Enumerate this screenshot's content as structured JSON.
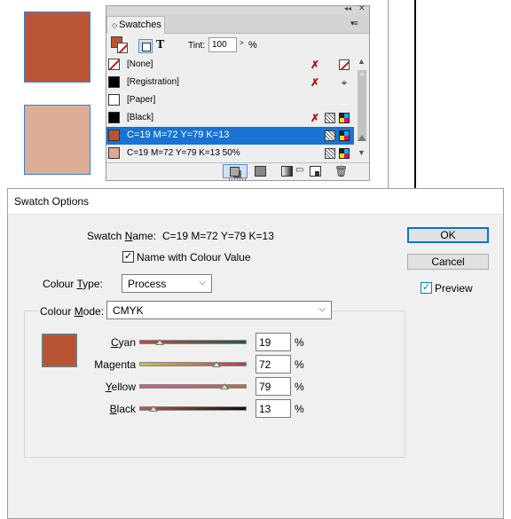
{
  "canvas": {
    "swatch_square_colors": [
      "#bb5738",
      "#ddae95"
    ]
  },
  "swatches_panel": {
    "tab_title": "Swatches",
    "tint_label": "Tint:",
    "tint_value": "100",
    "tint_unit": "%",
    "fill_color": "#b95433",
    "swatches": [
      {
        "name": "[None]",
        "chip": "none",
        "selected": false
      },
      {
        "name": "[Registration]",
        "chip": "#000000",
        "selected": false
      },
      {
        "name": "[Paper]",
        "chip": "#ffffff",
        "selected": false
      },
      {
        "name": "[Black]",
        "chip": "#000000",
        "selected": false
      },
      {
        "name": "C=19 M=72 Y=79 K=13",
        "chip": "#b95433",
        "selected": true
      },
      {
        "name": "C=19 M=72 Y=79 K=13 50%",
        "chip": "#dcaa91",
        "selected": false
      }
    ],
    "icons": {
      "no_edit": "pencil-crossed-icon",
      "registration": "registration-mark-icon",
      "process": "process-color-icon",
      "cmyk": "cmyk-mode-icon",
      "new_swatch": "new-swatch-icon",
      "delete": "trash-icon"
    }
  },
  "dialog": {
    "title": "Swatch Options",
    "swatch_name_label_pre": "Swatch ",
    "swatch_name_label_u": "N",
    "swatch_name_label_post": "ame:",
    "swatch_name_value": "C=19 M=72 Y=79 K=13",
    "name_with_colour_value_label": "Name with Colour Value",
    "name_with_colour_value_checked": true,
    "colour_type_label_pre": "Colour ",
    "colour_type_label_u": "T",
    "colour_type_label_post": "ype:",
    "colour_type_value": "Process",
    "colour_mode_label_pre": "Colour ",
    "colour_mode_label_u": "M",
    "colour_mode_label_post": "ode:",
    "colour_mode_value": "CMYK",
    "ok_label": "OK",
    "cancel_label": "Cancel",
    "preview_label": "Preview",
    "preview_checked": true,
    "preview_color": "#b95433",
    "sliders": [
      {
        "label_u": "C",
        "label_rest": "yan",
        "value": "19",
        "unit": "%",
        "fraction": 0.19,
        "gradient": [
          "#c24c34",
          "#1c5a4e"
        ]
      },
      {
        "label_u": "",
        "label_rest": "Magenta",
        "value": "72",
        "unit": "%",
        "fraction": 0.72,
        "gradient": [
          "#c9c24a",
          "#c2354a"
        ]
      },
      {
        "label_u": "Y",
        "label_rest": "ellow",
        "value": "79",
        "unit": "%",
        "fraction": 0.79,
        "gradient": [
          "#c85a9a",
          "#c26a30"
        ]
      },
      {
        "label_u": "B",
        "label_rest": "lack",
        "value": "13",
        "unit": "%",
        "fraction": 0.13,
        "gradient": [
          "#c2583a",
          "#1a0a08"
        ]
      }
    ]
  }
}
